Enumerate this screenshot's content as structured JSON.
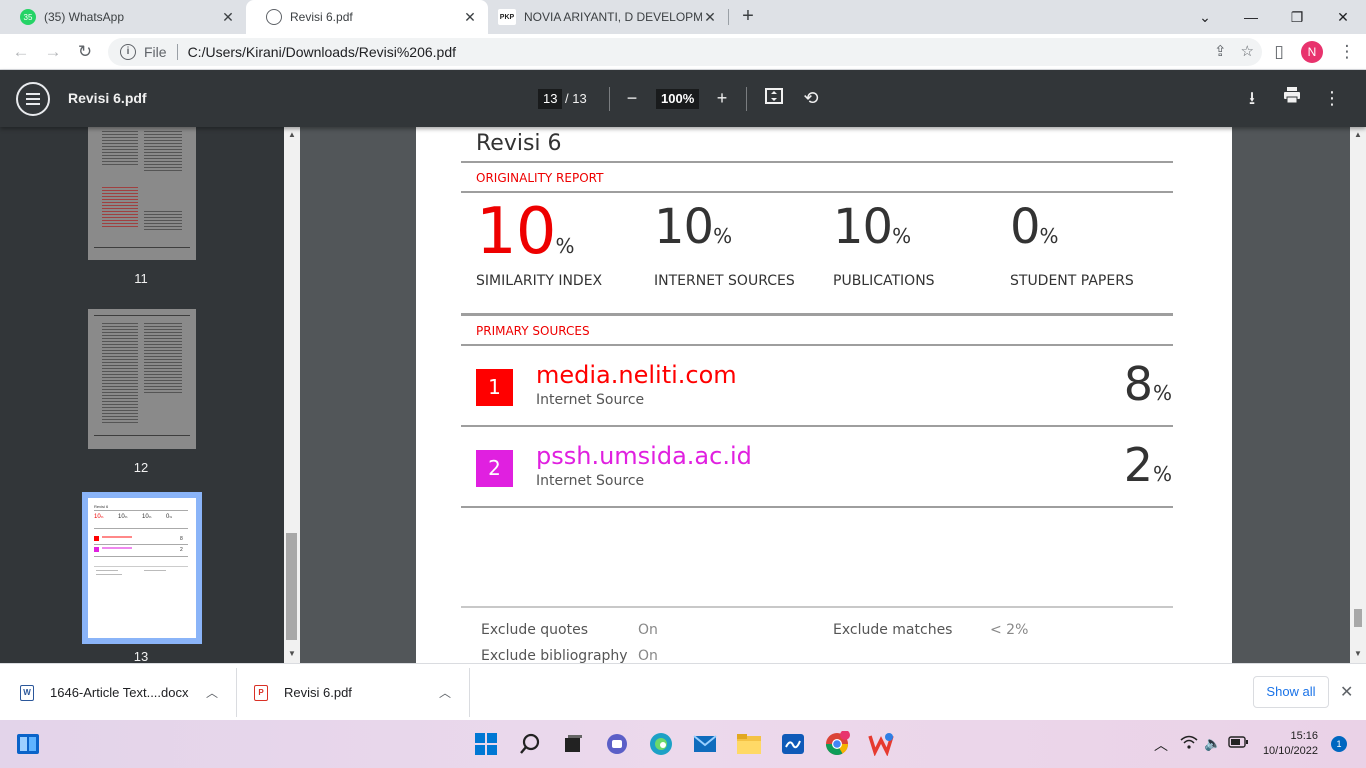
{
  "browser": {
    "tabs": [
      {
        "title": "(35) WhatsApp",
        "favicon_text": "35",
        "favicon_color": "#25d366"
      },
      {
        "title": "Revisi 6.pdf",
        "favicon_text": "",
        "favicon_color": "#5f6368"
      },
      {
        "title": "NOVIA ARIYANTI, D DEVELOPMENT",
        "favicon_text": "PKP",
        "favicon_color": "#ffffff"
      }
    ],
    "address": {
      "scheme": "File",
      "url": "C:/Users/Kirani/Downloads/Revisi%206.pdf"
    },
    "profile_initial": "N"
  },
  "pdf_viewer": {
    "filename": "Revisi 6.pdf",
    "current_page": "13",
    "total_pages": "/ 13",
    "zoom": "100%",
    "thumbnails": [
      {
        "page": "11"
      },
      {
        "page": "12"
      },
      {
        "page": "13"
      }
    ]
  },
  "report": {
    "title": "Revisi 6",
    "originality_heading": "ORIGINALITY REPORT",
    "stats": [
      {
        "value": "10",
        "unit": "%",
        "label": "SIMILARITY INDEX"
      },
      {
        "value": "10",
        "unit": "%",
        "label": "INTERNET SOURCES"
      },
      {
        "value": "10",
        "unit": "%",
        "label": "PUBLICATIONS"
      },
      {
        "value": "0",
        "unit": "%",
        "label": "STUDENT PAPERS"
      }
    ],
    "primary_heading": "PRIMARY SOURCES",
    "sources": [
      {
        "rank": "1",
        "name": "media.neliti.com",
        "type": "Internet Source",
        "percent": "8",
        "unit": "%",
        "color": "#ff0000"
      },
      {
        "rank": "2",
        "name": "pssh.umsida.ac.id",
        "type": "Internet Source",
        "percent": "2",
        "unit": "%",
        "color": "#e020e0"
      }
    ],
    "exclusions": {
      "quotes_label": "Exclude quotes",
      "quotes_value": "On",
      "matches_label": "Exclude matches",
      "matches_value": "< 2%",
      "bibliography_label": "Exclude bibliography",
      "bibliography_value": "On"
    }
  },
  "downloads": {
    "items": [
      {
        "name": "1646-Article Text....docx",
        "icon": "word-doc-icon"
      },
      {
        "name": "Revisi 6.pdf",
        "icon": "pdf-icon"
      }
    ],
    "show_all": "Show all"
  },
  "taskbar": {
    "time": "15:16",
    "date": "10/10/2022",
    "notification_count": "1"
  }
}
